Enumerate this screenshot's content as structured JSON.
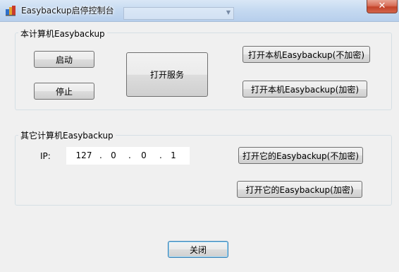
{
  "window": {
    "title": "Easybackup启停控制台",
    "close_glyph": "✕"
  },
  "local_group": {
    "label": "本计算机Easybackup",
    "start_label": "启动",
    "stop_label": "停止",
    "open_service_label": "打开服务",
    "open_local_unencrypted_label": "打开本机Easybackup(不加密)",
    "open_local_encrypted_label": "打开本机Easybackup(加密)"
  },
  "remote_group": {
    "label": "其它计算机Easybackup",
    "ip_label": "IP:",
    "ip": {
      "o1": "127",
      "o2": "0",
      "o3": "0",
      "o4": "1",
      "dot": "."
    },
    "open_remote_unencrypted_label": "打开它的Easybackup(不加密)",
    "open_remote_encrypted_label": "打开它的Easybackup(加密)"
  },
  "footer": {
    "close_label": "关闭"
  },
  "icons": {
    "app": "app-icon",
    "close": "close-icon",
    "dropdown": "chevron-down-icon"
  },
  "colors": {
    "titlebar": "#c6daf1",
    "close_button": "#c3432a",
    "background": "#f0f0f0",
    "focus_border": "#3c7fb1"
  }
}
